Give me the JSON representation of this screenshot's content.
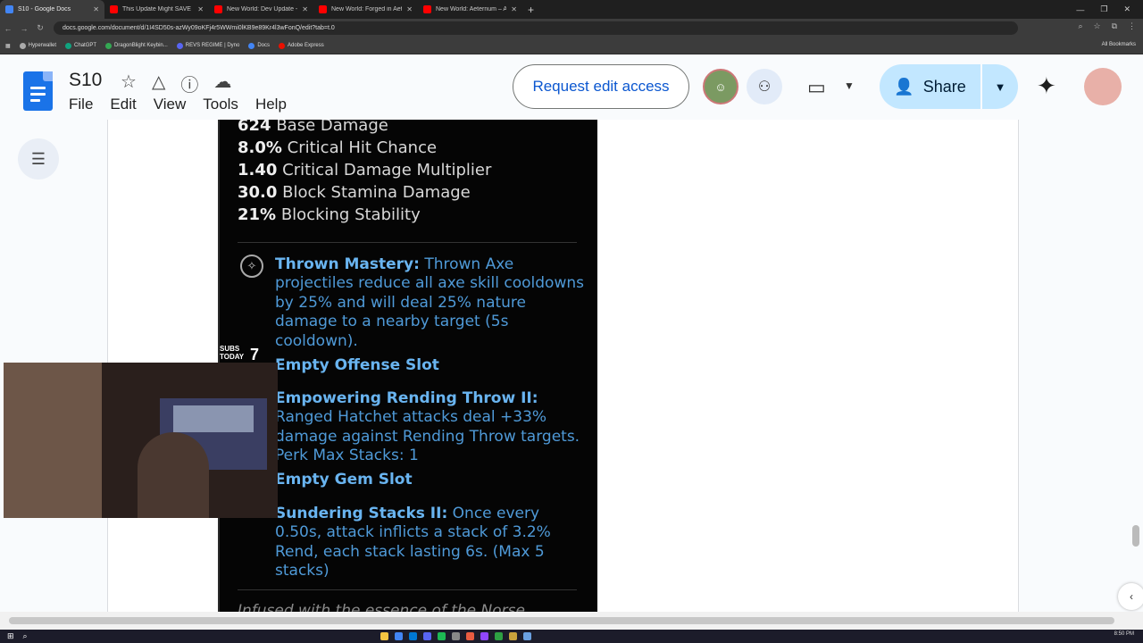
{
  "browser": {
    "tabs": [
      {
        "title": "S10 - Google Docs",
        "active": true,
        "favicon_color": "#4285f4"
      },
      {
        "title": "This Update Might SAVE New W",
        "active": false,
        "favicon_color": "#ff0000"
      },
      {
        "title": "New World: Dev Update - Octo",
        "active": false,
        "favicon_color": "#ff0000"
      },
      {
        "title": "New World: Forged in Aeternum",
        "active": false,
        "favicon_color": "#ff0000"
      },
      {
        "title": "New World: Aeternum – Annou",
        "active": false,
        "favicon_color": "#ff0000"
      }
    ],
    "new_tab": "+",
    "url": "docs.google.com/document/d/1I4SD50s-azWy09oKFj4r5WWmi0lKB9e89Kr4l3wFonQ/edit?tab=t.0",
    "bookmarks": [
      "Hyperwallet",
      "ChatGPT",
      "DragonBlight Keybin...",
      "REVS REGIME | Dyno",
      "Docs",
      "Adobe Express"
    ],
    "all_bookmarks": "All Bookmarks"
  },
  "docs": {
    "title": "S10",
    "menus": [
      "File",
      "Edit",
      "View",
      "Tools",
      "Help"
    ],
    "request_edit": "Request edit access",
    "share": "Share"
  },
  "tooltip": {
    "stats": [
      {
        "value": "624",
        "label": "Base Damage"
      },
      {
        "value": "8.0%",
        "label": "Critical Hit Chance"
      },
      {
        "value": "1.40",
        "label": "Critical Damage Multiplier"
      },
      {
        "value": "30.0",
        "label": "Block Stamina Damage"
      },
      {
        "value": "21%",
        "label": "Blocking Stability"
      }
    ],
    "perks": [
      {
        "name": "Thrown Mastery:",
        "desc": "Thrown Axe projectiles reduce all axe skill cooldowns by 25% and will deal 25% nature damage to a nearby target (5s cooldown)."
      },
      {
        "name": "Empty Offense Slot",
        "desc": ""
      },
      {
        "name": "Empowering Rending Throw II:",
        "desc": "Ranged Hatchet attacks deal +33% damage against Rending Throw targets. Perk Max Stacks: 1"
      },
      {
        "name": "Empty Gem Slot",
        "desc": ""
      },
      {
        "name": "Sundering Stacks II:",
        "desc": "Once every 0.50s, attack inflicts a stack of 3.2% Rend, each stack lasting 6s. (Max 5 stacks)"
      }
    ],
    "flavor": "Infused with the essence of the Norse"
  },
  "overlay": {
    "subs_label_1": "SUBS",
    "subs_label_2": "TODAY",
    "subs_count": "7"
  },
  "taskbar": {
    "time": "8:50 PM"
  }
}
